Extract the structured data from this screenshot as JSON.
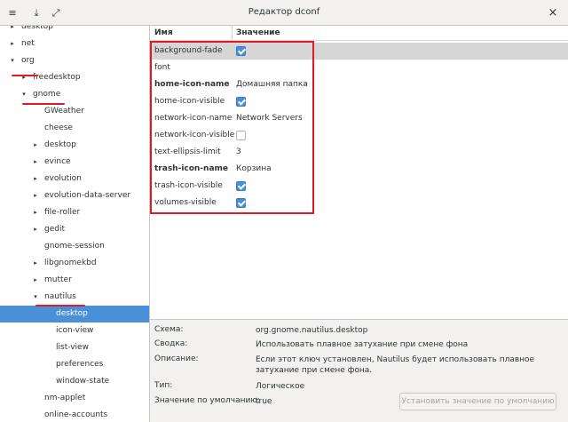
{
  "window": {
    "title": "Редактор dconf"
  },
  "toolbar": {
    "menu_icon": "≡",
    "download_icon": "⤓",
    "expand_icon": "⤢",
    "close_icon": "×"
  },
  "tree": {
    "items": [
      {
        "label": "desktop",
        "arrow": "▸",
        "indent": 0
      },
      {
        "label": "net",
        "arrow": "▸",
        "indent": 0
      },
      {
        "label": "org",
        "arrow": "▾",
        "indent": 0
      },
      {
        "label": "freedesktop",
        "arrow": "▸",
        "indent": 1
      },
      {
        "label": "gnome",
        "arrow": "▾",
        "indent": 1
      },
      {
        "label": "GWeather",
        "arrow": "",
        "indent": 2
      },
      {
        "label": "cheese",
        "arrow": "",
        "indent": 2
      },
      {
        "label": "desktop",
        "arrow": "▸",
        "indent": 2
      },
      {
        "label": "evince",
        "arrow": "▸",
        "indent": 2
      },
      {
        "label": "evolution",
        "arrow": "▸",
        "indent": 2
      },
      {
        "label": "evolution-data-server",
        "arrow": "▸",
        "indent": 2
      },
      {
        "label": "file-roller",
        "arrow": "▸",
        "indent": 2
      },
      {
        "label": "gedit",
        "arrow": "▸",
        "indent": 2
      },
      {
        "label": "gnome-session",
        "arrow": "",
        "indent": 2
      },
      {
        "label": "libgnomekbd",
        "arrow": "▸",
        "indent": 2
      },
      {
        "label": "mutter",
        "arrow": "▸",
        "indent": 2
      },
      {
        "label": "nautilus",
        "arrow": "▾",
        "indent": 2
      },
      {
        "label": "desktop",
        "arrow": "",
        "indent": 3,
        "selected": true
      },
      {
        "label": "icon-view",
        "arrow": "",
        "indent": 3
      },
      {
        "label": "list-view",
        "arrow": "",
        "indent": 3
      },
      {
        "label": "preferences",
        "arrow": "",
        "indent": 3
      },
      {
        "label": "window-state",
        "arrow": "",
        "indent": 3
      },
      {
        "label": "nm-applet",
        "arrow": "",
        "indent": 2
      },
      {
        "label": "online-accounts",
        "arrow": "",
        "indent": 2
      }
    ]
  },
  "table": {
    "col_name": "Имя",
    "col_value": "Значение",
    "rows": [
      {
        "name": "background-fade",
        "type": "bool",
        "checked": true,
        "bold": false,
        "highlight": true
      },
      {
        "name": "font",
        "type": "text",
        "value": "",
        "bold": false
      },
      {
        "name": "home-icon-name",
        "type": "text",
        "value": "Домашняя папка",
        "bold": true
      },
      {
        "name": "home-icon-visible",
        "type": "bool",
        "checked": true,
        "bold": false
      },
      {
        "name": "network-icon-name",
        "type": "text",
        "value": "Network Servers",
        "bold": false
      },
      {
        "name": "network-icon-visible",
        "type": "bool",
        "checked": false,
        "bold": false
      },
      {
        "name": "text-ellipsis-limit",
        "type": "text",
        "value": "3",
        "bold": false
      },
      {
        "name": "trash-icon-name",
        "type": "text",
        "value": "Корзина",
        "bold": true
      },
      {
        "name": "trash-icon-visible",
        "type": "bool",
        "checked": true,
        "bold": false
      },
      {
        "name": "volumes-visible",
        "type": "bool",
        "checked": true,
        "bold": false
      }
    ]
  },
  "info": {
    "schema_label": "Схема:",
    "schema_value": "org.gnome.nautilus.desktop",
    "summary_label": "Сводка:",
    "summary_value": "Использовать плавное затухание при смене фона",
    "description_label": "Описание:",
    "description_value": "Если этот ключ установлен, Nautilus будет использовать плавное затухание при смене фона.",
    "type_label": "Тип:",
    "type_value": "Логическое",
    "default_label": "Значение по умолчанию:",
    "default_value": "true",
    "reset_button": "Установить значение по умолчанию"
  },
  "colors": {
    "selection": "#4a90d9",
    "annotation": "#e01b24"
  }
}
